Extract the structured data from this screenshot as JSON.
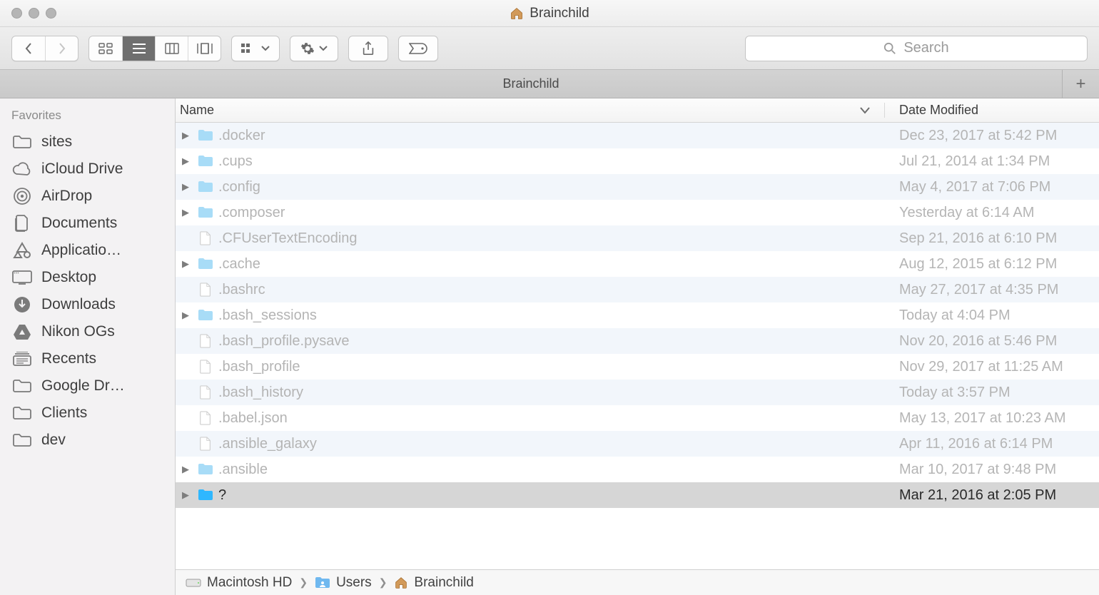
{
  "window": {
    "title": "Brainchild"
  },
  "tabbar": {
    "active_tab": "Brainchild",
    "newtab_label": "+"
  },
  "search": {
    "placeholder": "Search"
  },
  "sidebar": {
    "section": "Favorites",
    "items": [
      {
        "icon": "folder",
        "label": "sites"
      },
      {
        "icon": "cloud",
        "label": "iCloud Drive"
      },
      {
        "icon": "airdrop",
        "label": "AirDrop"
      },
      {
        "icon": "documents",
        "label": "Documents"
      },
      {
        "icon": "applications",
        "label": "Applicatio…"
      },
      {
        "icon": "desktop",
        "label": "Desktop"
      },
      {
        "icon": "downloads",
        "label": "Downloads"
      },
      {
        "icon": "gdrive",
        "label": "Nikon OGs"
      },
      {
        "icon": "recents",
        "label": "Recents"
      },
      {
        "icon": "folder",
        "label": "Google Dr…"
      },
      {
        "icon": "folder",
        "label": "Clients"
      },
      {
        "icon": "folder",
        "label": "dev"
      }
    ]
  },
  "columns": {
    "name": "Name",
    "modified": "Date Modified"
  },
  "files": [
    {
      "type": "folder",
      "name": ".docker",
      "modified": "Dec 23, 2017 at 5:42 PM"
    },
    {
      "type": "folder",
      "name": ".cups",
      "modified": "Jul 21, 2014 at 1:34 PM"
    },
    {
      "type": "folder",
      "name": ".config",
      "modified": "May 4, 2017 at 7:06 PM"
    },
    {
      "type": "folder",
      "name": ".composer",
      "modified": "Yesterday at 6:14 AM"
    },
    {
      "type": "file",
      "name": ".CFUserTextEncoding",
      "modified": "Sep 21, 2016 at 6:10 PM"
    },
    {
      "type": "folder",
      "name": ".cache",
      "modified": "Aug 12, 2015 at 6:12 PM"
    },
    {
      "type": "file",
      "name": ".bashrc",
      "modified": "May 27, 2017 at 4:35 PM"
    },
    {
      "type": "folder",
      "name": ".bash_sessions",
      "modified": "Today at 4:04 PM"
    },
    {
      "type": "file",
      "name": ".bash_profile.pysave",
      "modified": "Nov 20, 2016 at 5:46 PM"
    },
    {
      "type": "file",
      "name": ".bash_profile",
      "modified": "Nov 29, 2017 at 11:25 AM"
    },
    {
      "type": "file",
      "name": ".bash_history",
      "modified": "Today at 3:57 PM"
    },
    {
      "type": "file",
      "name": ".babel.json",
      "modified": "May 13, 2017 at 10:23 AM"
    },
    {
      "type": "file",
      "name": ".ansible_galaxy",
      "modified": "Apr 11, 2016 at 6:14 PM"
    },
    {
      "type": "folder",
      "name": ".ansible",
      "modified": "Mar 10, 2017 at 9:48 PM"
    },
    {
      "type": "folder",
      "name": "?",
      "modified": "Mar 21, 2016 at 2:05 PM",
      "selected": true
    }
  ],
  "path": [
    {
      "icon": "disk",
      "label": "Macintosh HD"
    },
    {
      "icon": "userfolder",
      "label": "Users"
    },
    {
      "icon": "home",
      "label": "Brainchild"
    }
  ]
}
